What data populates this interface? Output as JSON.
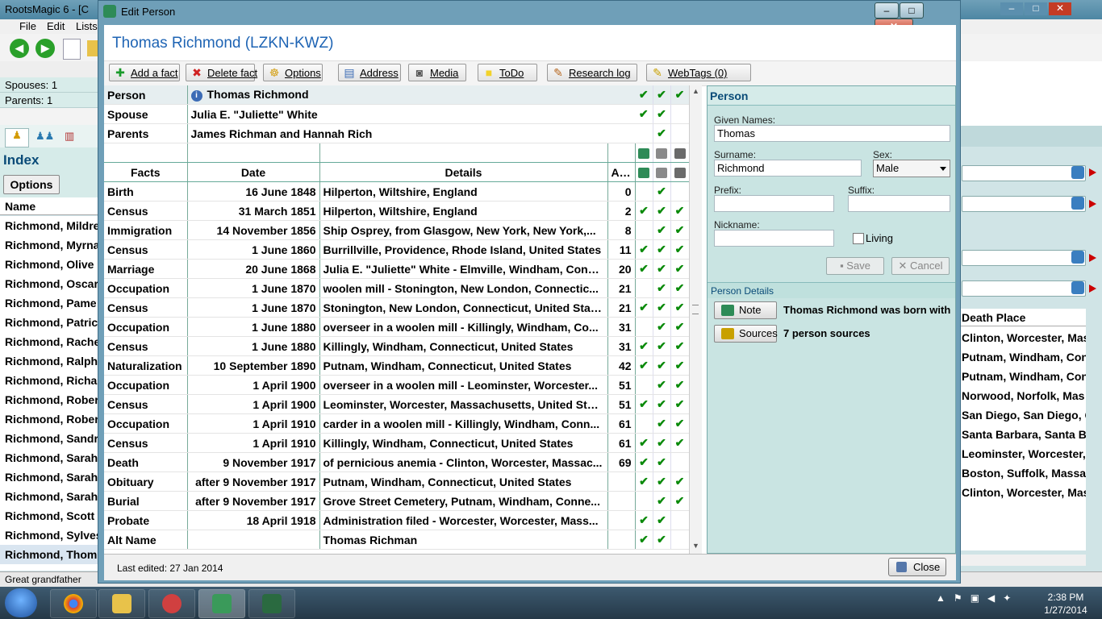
{
  "background_app": {
    "title": "RootsMagic 6 - [C",
    "menu": [
      "File",
      "Edit",
      "Lists"
    ],
    "spouses": "Spouses: 1",
    "parents": "Parents: 1",
    "index_title": "Index",
    "options_label": "Options",
    "name_header": "Name",
    "names": [
      "Richmond, Mildre",
      "Richmond, Myrna",
      "Richmond, Olive",
      "Richmond, Oscar",
      "Richmond, Pame",
      "Richmond, Patric",
      "Richmond, Rache",
      "Richmond, Ralph",
      "Richmond, Richa",
      "Richmond, Rober",
      "Richmond, Rober",
      "Richmond, Sandr",
      "Richmond, Sarah",
      "Richmond, Sarah",
      "Richmond, Sarah",
      "Richmond, Scott",
      "Richmond, Sylves",
      "Richmond, Thom"
    ],
    "death_place_header": "Death Place",
    "death_places": [
      "Clinton, Worcester, Mas",
      "Putnam, Windham, Con",
      "Putnam, Windham, Con",
      "Norwood, Norfolk, Mas",
      "San Diego, San Diego, C",
      "Santa Barbara, Santa Ba",
      "Leominster, Worcester,",
      "Boston, Suffolk, Massac",
      "Clinton, Worcester, Mas"
    ],
    "status_text": "Great grandfather"
  },
  "taskbar": {
    "time": "2:38 PM",
    "date": "1/27/2014"
  },
  "dialog": {
    "title": "Edit Person",
    "person_heading": "Thomas Richmond (LZKN-KWZ)",
    "toolbar": [
      {
        "label": "Add a fact",
        "icon": "plus-icon",
        "glyph": "✚",
        "color": "#1a9a2a"
      },
      {
        "label": "Delete fact",
        "icon": "delete-icon",
        "glyph": "✖",
        "color": "#d02020"
      },
      {
        "label": "Options",
        "icon": "options-icon",
        "glyph": "☸",
        "color": "#d4a017"
      },
      {
        "label": "Address",
        "icon": "address-icon",
        "glyph": "▤",
        "color": "#3b6bb5"
      },
      {
        "label": "Media",
        "icon": "media-icon",
        "glyph": "◙",
        "color": "#555"
      },
      {
        "label": "ToDo",
        "icon": "todo-icon",
        "glyph": "■",
        "color": "#f2d22a"
      },
      {
        "label": "Research log",
        "icon": "research-log-icon",
        "glyph": "✎",
        "color": "#b5651d"
      },
      {
        "label": "WebTags (0)",
        "icon": "webtags-icon",
        "glyph": "✎",
        "color": "#c8a000"
      }
    ],
    "family_rows": [
      {
        "label": "Person",
        "value": "Thomas Richmond",
        "icon": "info-icon",
        "checks": [
          true,
          true,
          true
        ]
      },
      {
        "label": "Spouse",
        "value": "Julia E. \"Juliette\" White",
        "checks": [
          true,
          true,
          false
        ]
      },
      {
        "label": "Parents",
        "value": "James Richman and Hannah Rich",
        "checks": [
          false,
          true,
          false
        ]
      }
    ],
    "columns": {
      "facts": "Facts",
      "date": "Date",
      "details": "Details",
      "age": "Age"
    },
    "facts": [
      {
        "fact": "Birth",
        "date": "16 June 1848",
        "details": "Hilperton, Wiltshire, England",
        "age": "0",
        "checks": [
          false,
          true,
          false
        ]
      },
      {
        "fact": "Census",
        "date": "31 March 1851",
        "details": "Hilperton, Wiltshire, England",
        "age": "2",
        "checks": [
          true,
          true,
          true
        ]
      },
      {
        "fact": "Immigration",
        "date": "14 November 1856",
        "details": "Ship Osprey, from Glasgow, New York, New York,...",
        "age": "8",
        "checks": [
          false,
          true,
          true
        ]
      },
      {
        "fact": "Census",
        "date": "1 June 1860",
        "details": "Burrillville, Providence, Rhode Island, United States",
        "age": "11",
        "checks": [
          true,
          true,
          true
        ]
      },
      {
        "fact": "Marriage",
        "date": "20 June 1868",
        "details": "Julia E. \"Juliette\" White - Elmville, Windham, Conn...",
        "age": "20",
        "checks": [
          true,
          true,
          true
        ]
      },
      {
        "fact": "Occupation",
        "date": "1 June 1870",
        "details": "woolen mill - Stonington, New London, Connectic...",
        "age": "21",
        "checks": [
          false,
          true,
          true
        ]
      },
      {
        "fact": "Census",
        "date": "1 June 1870",
        "details": "Stonington, New London, Connecticut, United States",
        "age": "21",
        "checks": [
          true,
          true,
          true
        ]
      },
      {
        "fact": "Occupation",
        "date": "1 June 1880",
        "details": "overseer in a woolen mill - Killingly, Windham, Co...",
        "age": "31",
        "checks": [
          false,
          true,
          true
        ]
      },
      {
        "fact": "Census",
        "date": "1 June 1880",
        "details": "Killingly, Windham, Connecticut, United States",
        "age": "31",
        "checks": [
          true,
          true,
          true
        ]
      },
      {
        "fact": "Naturalization",
        "date": "10 September 1890",
        "details": "Putnam, Windham, Connecticut, United States",
        "age": "42",
        "checks": [
          true,
          true,
          true
        ]
      },
      {
        "fact": "Occupation",
        "date": "1 April 1900",
        "details": "overseer in a woolen mill - Leominster, Worcester...",
        "age": "51",
        "checks": [
          false,
          true,
          true
        ]
      },
      {
        "fact": "Census",
        "date": "1 April 1900",
        "details": "Leominster, Worcester, Massachusetts, United Stat...",
        "age": "51",
        "checks": [
          true,
          true,
          true
        ]
      },
      {
        "fact": "Occupation",
        "date": "1 April 1910",
        "details": "carder in a woolen mill - Killingly, Windham, Conn...",
        "age": "61",
        "checks": [
          false,
          true,
          true
        ]
      },
      {
        "fact": "Census",
        "date": "1 April 1910",
        "details": "Killingly, Windham, Connecticut, United States",
        "age": "61",
        "checks": [
          true,
          true,
          true
        ]
      },
      {
        "fact": "Death",
        "date": "9 November 1917",
        "details": "of pernicious anemia - Clinton, Worcester, Massac...",
        "age": "69",
        "checks": [
          true,
          true,
          false
        ]
      },
      {
        "fact": "Obituary",
        "date": "after 9 November 1917",
        "details": "Putnam, Windham, Connecticut, United States",
        "age": "",
        "checks": [
          true,
          true,
          true
        ]
      },
      {
        "fact": "Burial",
        "date": "after 9 November 1917",
        "details": "Grove Street Cemetery, Putnam, Windham, Conne...",
        "age": "",
        "checks": [
          false,
          true,
          true
        ]
      },
      {
        "fact": "Probate",
        "date": "18 April 1918",
        "details": "Administration filed - Worcester, Worcester, Mass...",
        "age": "",
        "checks": [
          true,
          true,
          false
        ]
      },
      {
        "fact": "Alt Name",
        "date": "",
        "details": "Thomas Richman",
        "age": "",
        "checks": [
          true,
          true,
          false
        ]
      }
    ],
    "person_panel": {
      "title": "Person",
      "given_names_label": "Given Names:",
      "given_names_value": "Thomas",
      "surname_label": "Surname:",
      "surname_value": "Richmond",
      "sex_label": "Sex:",
      "sex_value": "Male",
      "prefix_label": "Prefix:",
      "prefix_value": "",
      "suffix_label": "Suffix:",
      "suffix_value": "",
      "nickname_label": "Nickname:",
      "nickname_value": "",
      "living_label": "Living",
      "save_label": "Save",
      "cancel_label": "Cancel"
    },
    "person_details": {
      "title": "Person Details",
      "note_label": "Note",
      "note_text": "Thomas Richmond was born with the",
      "sources_label": "Sources",
      "sources_text": "7 person sources"
    },
    "footer": {
      "last_edited": "Last edited: 27 Jan 2014",
      "close_label": "Close"
    }
  }
}
